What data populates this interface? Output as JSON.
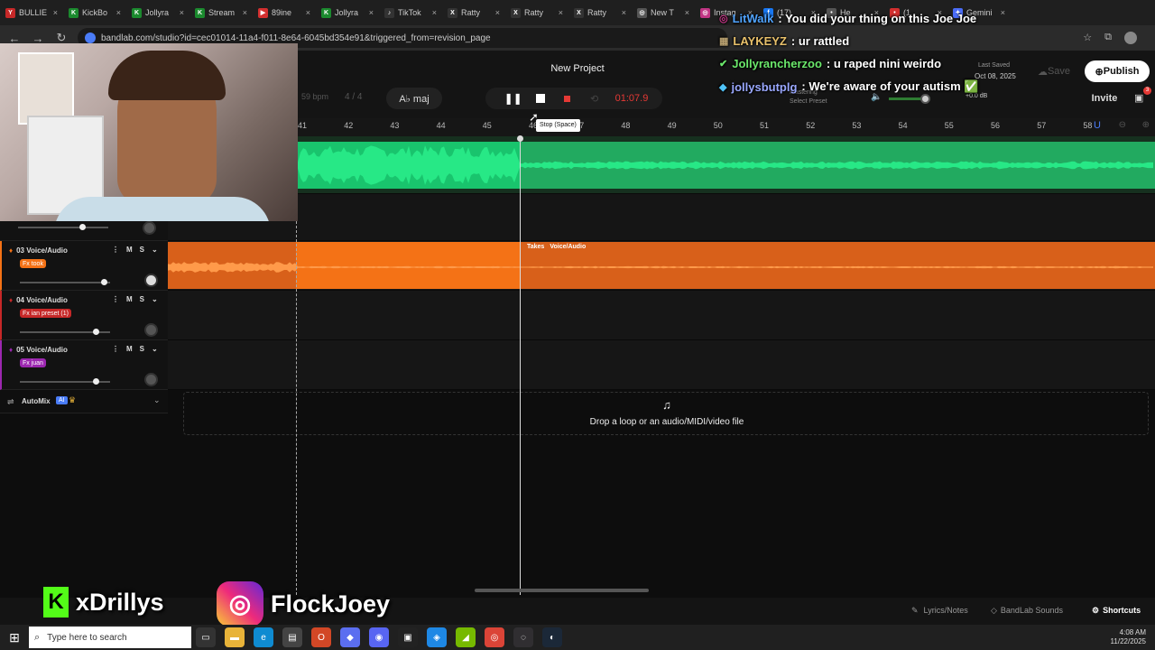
{
  "browser": {
    "tabs": [
      {
        "label": "BULLIE",
        "color": "#c62828",
        "glyph": "Y"
      },
      {
        "label": "KickBo",
        "color": "#1b8a2e",
        "glyph": "K"
      },
      {
        "label": "Jollyra",
        "color": "#1b8a2e",
        "glyph": "K"
      },
      {
        "label": "Stream",
        "color": "#1b8a2e",
        "glyph": "K"
      },
      {
        "label": "89ine",
        "color": "#d32f2f",
        "glyph": "▶"
      },
      {
        "label": "Jollyra",
        "color": "#1b8a2e",
        "glyph": "K"
      },
      {
        "label": "TikTok",
        "color": "#333",
        "glyph": "♪"
      },
      {
        "label": "Ratty",
        "color": "#333",
        "glyph": "X"
      },
      {
        "label": "Ratty",
        "color": "#333",
        "glyph": "X"
      },
      {
        "label": "Ratty",
        "color": "#333",
        "glyph": "X"
      },
      {
        "label": "New T",
        "color": "#555",
        "glyph": "◎"
      },
      {
        "label": "Instag",
        "color": "#c13584",
        "glyph": "◎"
      },
      {
        "label": "(17)",
        "color": "#1877f2",
        "glyph": "f"
      },
      {
        "label": "He",
        "color": "#555",
        "glyph": "•"
      },
      {
        "label": "(1",
        "color": "#d32f2f",
        "glyph": "•"
      },
      {
        "label": "Gemini",
        "color": "#4a6cf7",
        "glyph": "✦"
      }
    ],
    "url": "bandlab.com/studio?id=cec01014-11a4-f011-8e64-6045bd354e91&triggered_from=revision_page"
  },
  "chat": [
    {
      "user": "LitWalk",
      "text": ": You did your thing on this Joe Joe",
      "color": "#4fa3ff"
    },
    {
      "user": "LAYKEYZ",
      "text": ": ur rattled",
      "color": "#e8c06a"
    },
    {
      "user": "Jollyrancherzoo",
      "text": ": u raped nini weirdo",
      "color": "#6be86b"
    },
    {
      "user": "jollysbutplg",
      "text": ": We're aware of your autism ✅",
      "color": "#9aa8ff"
    }
  ],
  "project": {
    "title": "New Project",
    "last_saved_label": "Last Saved",
    "last_saved_date": "Oct 08, 2025",
    "save": "Save",
    "publish": "Publish",
    "invite": "Invite",
    "notif_count": "3"
  },
  "transport": {
    "bpm": "59 bpm",
    "time_sig": "4 / 4",
    "key": "A♭ maj",
    "time": "01:07.9",
    "tooltip": "Stop (Space)",
    "mastering": "Mastering",
    "select_preset": "Select Preset",
    "db": "+0.0 dB"
  },
  "ruler": [
    "41",
    "42",
    "43",
    "44",
    "45",
    "46",
    "47",
    "48",
    "49",
    "50",
    "51",
    "52",
    "53",
    "54",
    "55",
    "56",
    "57",
    "58"
  ],
  "tracks": [
    {
      "name": "03 Voice/Audio",
      "fx": "Fx took",
      "fx_color": "#f47216",
      "volume": 0.95
    },
    {
      "name": "04 Voice/Audio",
      "fx": "Fx ian preset (1)",
      "fx_color": "#c62828",
      "volume": 0.85
    },
    {
      "name": "05 Voice/Audio",
      "fx": "Fx juan",
      "fx_color": "#9c27b0",
      "volume": 0.85
    }
  ],
  "track_ctl": {
    "m": "M",
    "s": "S"
  },
  "region": {
    "takes": "Takes",
    "name": "Voice/Audio"
  },
  "automix": {
    "label": "AutoMix",
    "badge": "AI"
  },
  "drop_text": "Drop a loop or an audio/MIDI/video file",
  "bottom": {
    "lyrics": "Lyrics/Notes",
    "sounds": "BandLab Sounds",
    "shortcuts": "Shortcuts"
  },
  "socials": {
    "kick": "xDrillys",
    "instagram": "FlockJoey"
  },
  "taskbar": {
    "search": "Type here to search",
    "time": "4:08 AM",
    "date": "11/22/2025"
  }
}
